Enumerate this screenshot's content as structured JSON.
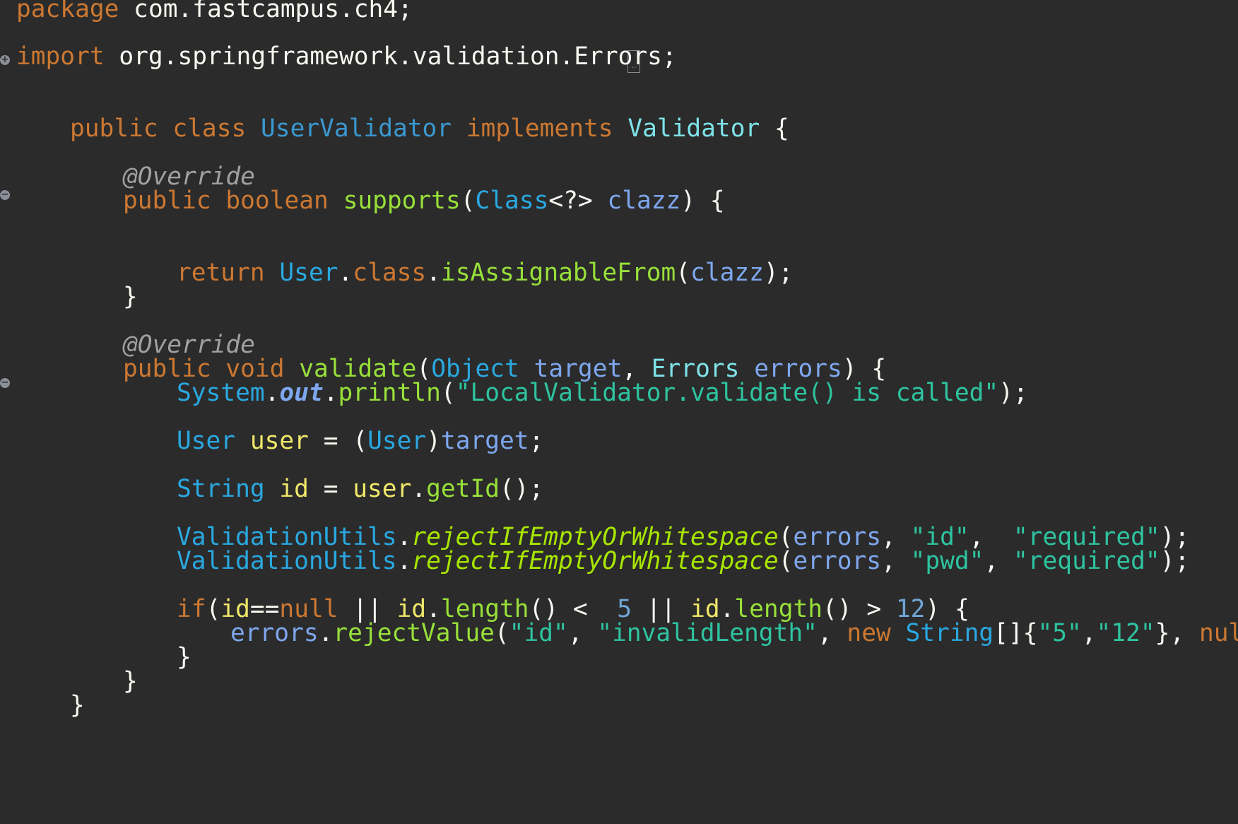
{
  "editor": {
    "language": "java",
    "theme_colors": {
      "background": "#2b2b2b",
      "keyword": "#cc7832",
      "class_name": "#3a98d0",
      "type": "#2aa8e0",
      "interface": "#7fe3e9",
      "method": "#98e03a",
      "parameter": "#7ea7ee",
      "local_variable": "#f0e86a",
      "string": "#2ec4a0",
      "number": "#6fa6d6",
      "annotation": "#a0a0a0",
      "plain": "#f8f8f2"
    },
    "lines": [
      [
        [
          "kw",
          "package"
        ],
        [
          "plain",
          " com.fastcampus.ch4;"
        ]
      ],
      [
        [
          "kw",
          "import"
        ],
        [
          "plain",
          " org.springframework.validation.Errors;"
        ]
      ],
      [
        [
          "kw",
          "public class "
        ],
        [
          "class",
          "UserValidator"
        ],
        [
          "kw",
          " implements "
        ],
        [
          "iface",
          "Validator"
        ],
        [
          "plain",
          " {"
        ]
      ],
      [
        [
          "anno",
          "@Override"
        ]
      ],
      [
        [
          "kw",
          "public boolean "
        ],
        [
          "method",
          "supports"
        ],
        [
          "plain",
          "("
        ],
        [
          "type",
          "Class"
        ],
        [
          "plain",
          "<?> "
        ],
        [
          "param",
          "clazz"
        ],
        [
          "plain",
          ") {"
        ]
      ],
      [
        [
          "kw",
          "return "
        ],
        [
          "type",
          "User"
        ],
        [
          "plain",
          "."
        ],
        [
          "kw",
          "class"
        ],
        [
          "plain",
          "."
        ],
        [
          "method",
          "isAssignableFrom"
        ],
        [
          "plain",
          "("
        ],
        [
          "param",
          "clazz"
        ],
        [
          "plain",
          ");"
        ]
      ],
      [
        [
          "plain",
          "}"
        ]
      ],
      [
        [
          "anno",
          "@Override"
        ]
      ],
      [
        [
          "kw",
          "public void "
        ],
        [
          "method",
          "validate"
        ],
        [
          "plain",
          "("
        ],
        [
          "type",
          "Object"
        ],
        [
          "plain",
          " "
        ],
        [
          "param",
          "target"
        ],
        [
          "plain",
          ", "
        ],
        [
          "iface",
          "Errors"
        ],
        [
          "plain",
          " "
        ],
        [
          "param",
          "errors"
        ],
        [
          "plain",
          ") {"
        ]
      ],
      [
        [
          "type",
          "System"
        ],
        [
          "plain",
          "."
        ],
        [
          "field",
          "out"
        ],
        [
          "plain",
          "."
        ],
        [
          "method",
          "println"
        ],
        [
          "plain",
          "("
        ],
        [
          "str",
          "\"LocalValidator.validate() is called\""
        ],
        [
          "plain",
          ");"
        ]
      ],
      [
        [
          "type",
          "User"
        ],
        [
          "plain",
          " "
        ],
        [
          "local",
          "user"
        ],
        [
          "plain",
          " = ("
        ],
        [
          "type",
          "User"
        ],
        [
          "plain",
          ")"
        ],
        [
          "param",
          "target"
        ],
        [
          "plain",
          ";"
        ]
      ],
      [
        [
          "type",
          "String"
        ],
        [
          "plain",
          " "
        ],
        [
          "local",
          "id"
        ],
        [
          "plain",
          " = "
        ],
        [
          "local",
          "user"
        ],
        [
          "plain",
          "."
        ],
        [
          "method",
          "getId"
        ],
        [
          "plain",
          "();"
        ]
      ],
      [
        [
          "type",
          "ValidationUtils"
        ],
        [
          "plain",
          "."
        ],
        [
          "static",
          "rejectIfEmptyOrWhitespace"
        ],
        [
          "plain",
          "("
        ],
        [
          "param",
          "errors"
        ],
        [
          "plain",
          ", "
        ],
        [
          "str",
          "\"id\""
        ],
        [
          "plain",
          ",  "
        ],
        [
          "str",
          "\"required\""
        ],
        [
          "plain",
          ");"
        ]
      ],
      [
        [
          "type",
          "ValidationUtils"
        ],
        [
          "plain",
          "."
        ],
        [
          "static",
          "rejectIfEmptyOrWhitespace"
        ],
        [
          "plain",
          "("
        ],
        [
          "param",
          "errors"
        ],
        [
          "plain",
          ", "
        ],
        [
          "str",
          "\"pwd\""
        ],
        [
          "plain",
          ", "
        ],
        [
          "str",
          "\"required\""
        ],
        [
          "plain",
          ");"
        ]
      ],
      [
        [
          "kw",
          "if"
        ],
        [
          "plain",
          "("
        ],
        [
          "local",
          "id"
        ],
        [
          "plain",
          "=="
        ],
        [
          "kw",
          "null"
        ],
        [
          "plain",
          " || "
        ],
        [
          "local",
          "id"
        ],
        [
          "plain",
          "."
        ],
        [
          "method",
          "length"
        ],
        [
          "plain",
          "() <  "
        ],
        [
          "num",
          "5"
        ],
        [
          "plain",
          " || "
        ],
        [
          "local",
          "id"
        ],
        [
          "plain",
          "."
        ],
        [
          "method",
          "length"
        ],
        [
          "plain",
          "() > "
        ],
        [
          "num",
          "12"
        ],
        [
          "plain",
          ") {"
        ]
      ],
      [
        [
          "param",
          "errors"
        ],
        [
          "plain",
          "."
        ],
        [
          "method",
          "rejectValue"
        ],
        [
          "plain",
          "("
        ],
        [
          "str",
          "\"id\""
        ],
        [
          "plain",
          ", "
        ],
        [
          "str",
          "\"invalidLength\""
        ],
        [
          "plain",
          ", "
        ],
        [
          "kw",
          "new "
        ],
        [
          "type",
          "String"
        ],
        [
          "plain",
          "[]{"
        ],
        [
          "str",
          "\"5\""
        ],
        [
          "plain",
          ","
        ],
        [
          "str",
          "\"12\""
        ],
        [
          "plain",
          "}, "
        ],
        [
          "kw",
          "null"
        ],
        [
          "plain",
          ");"
        ]
      ],
      [
        [
          "plain",
          "}"
        ]
      ],
      [
        [
          "plain",
          "}"
        ]
      ],
      [
        [
          "plain",
          "}"
        ]
      ]
    ]
  }
}
